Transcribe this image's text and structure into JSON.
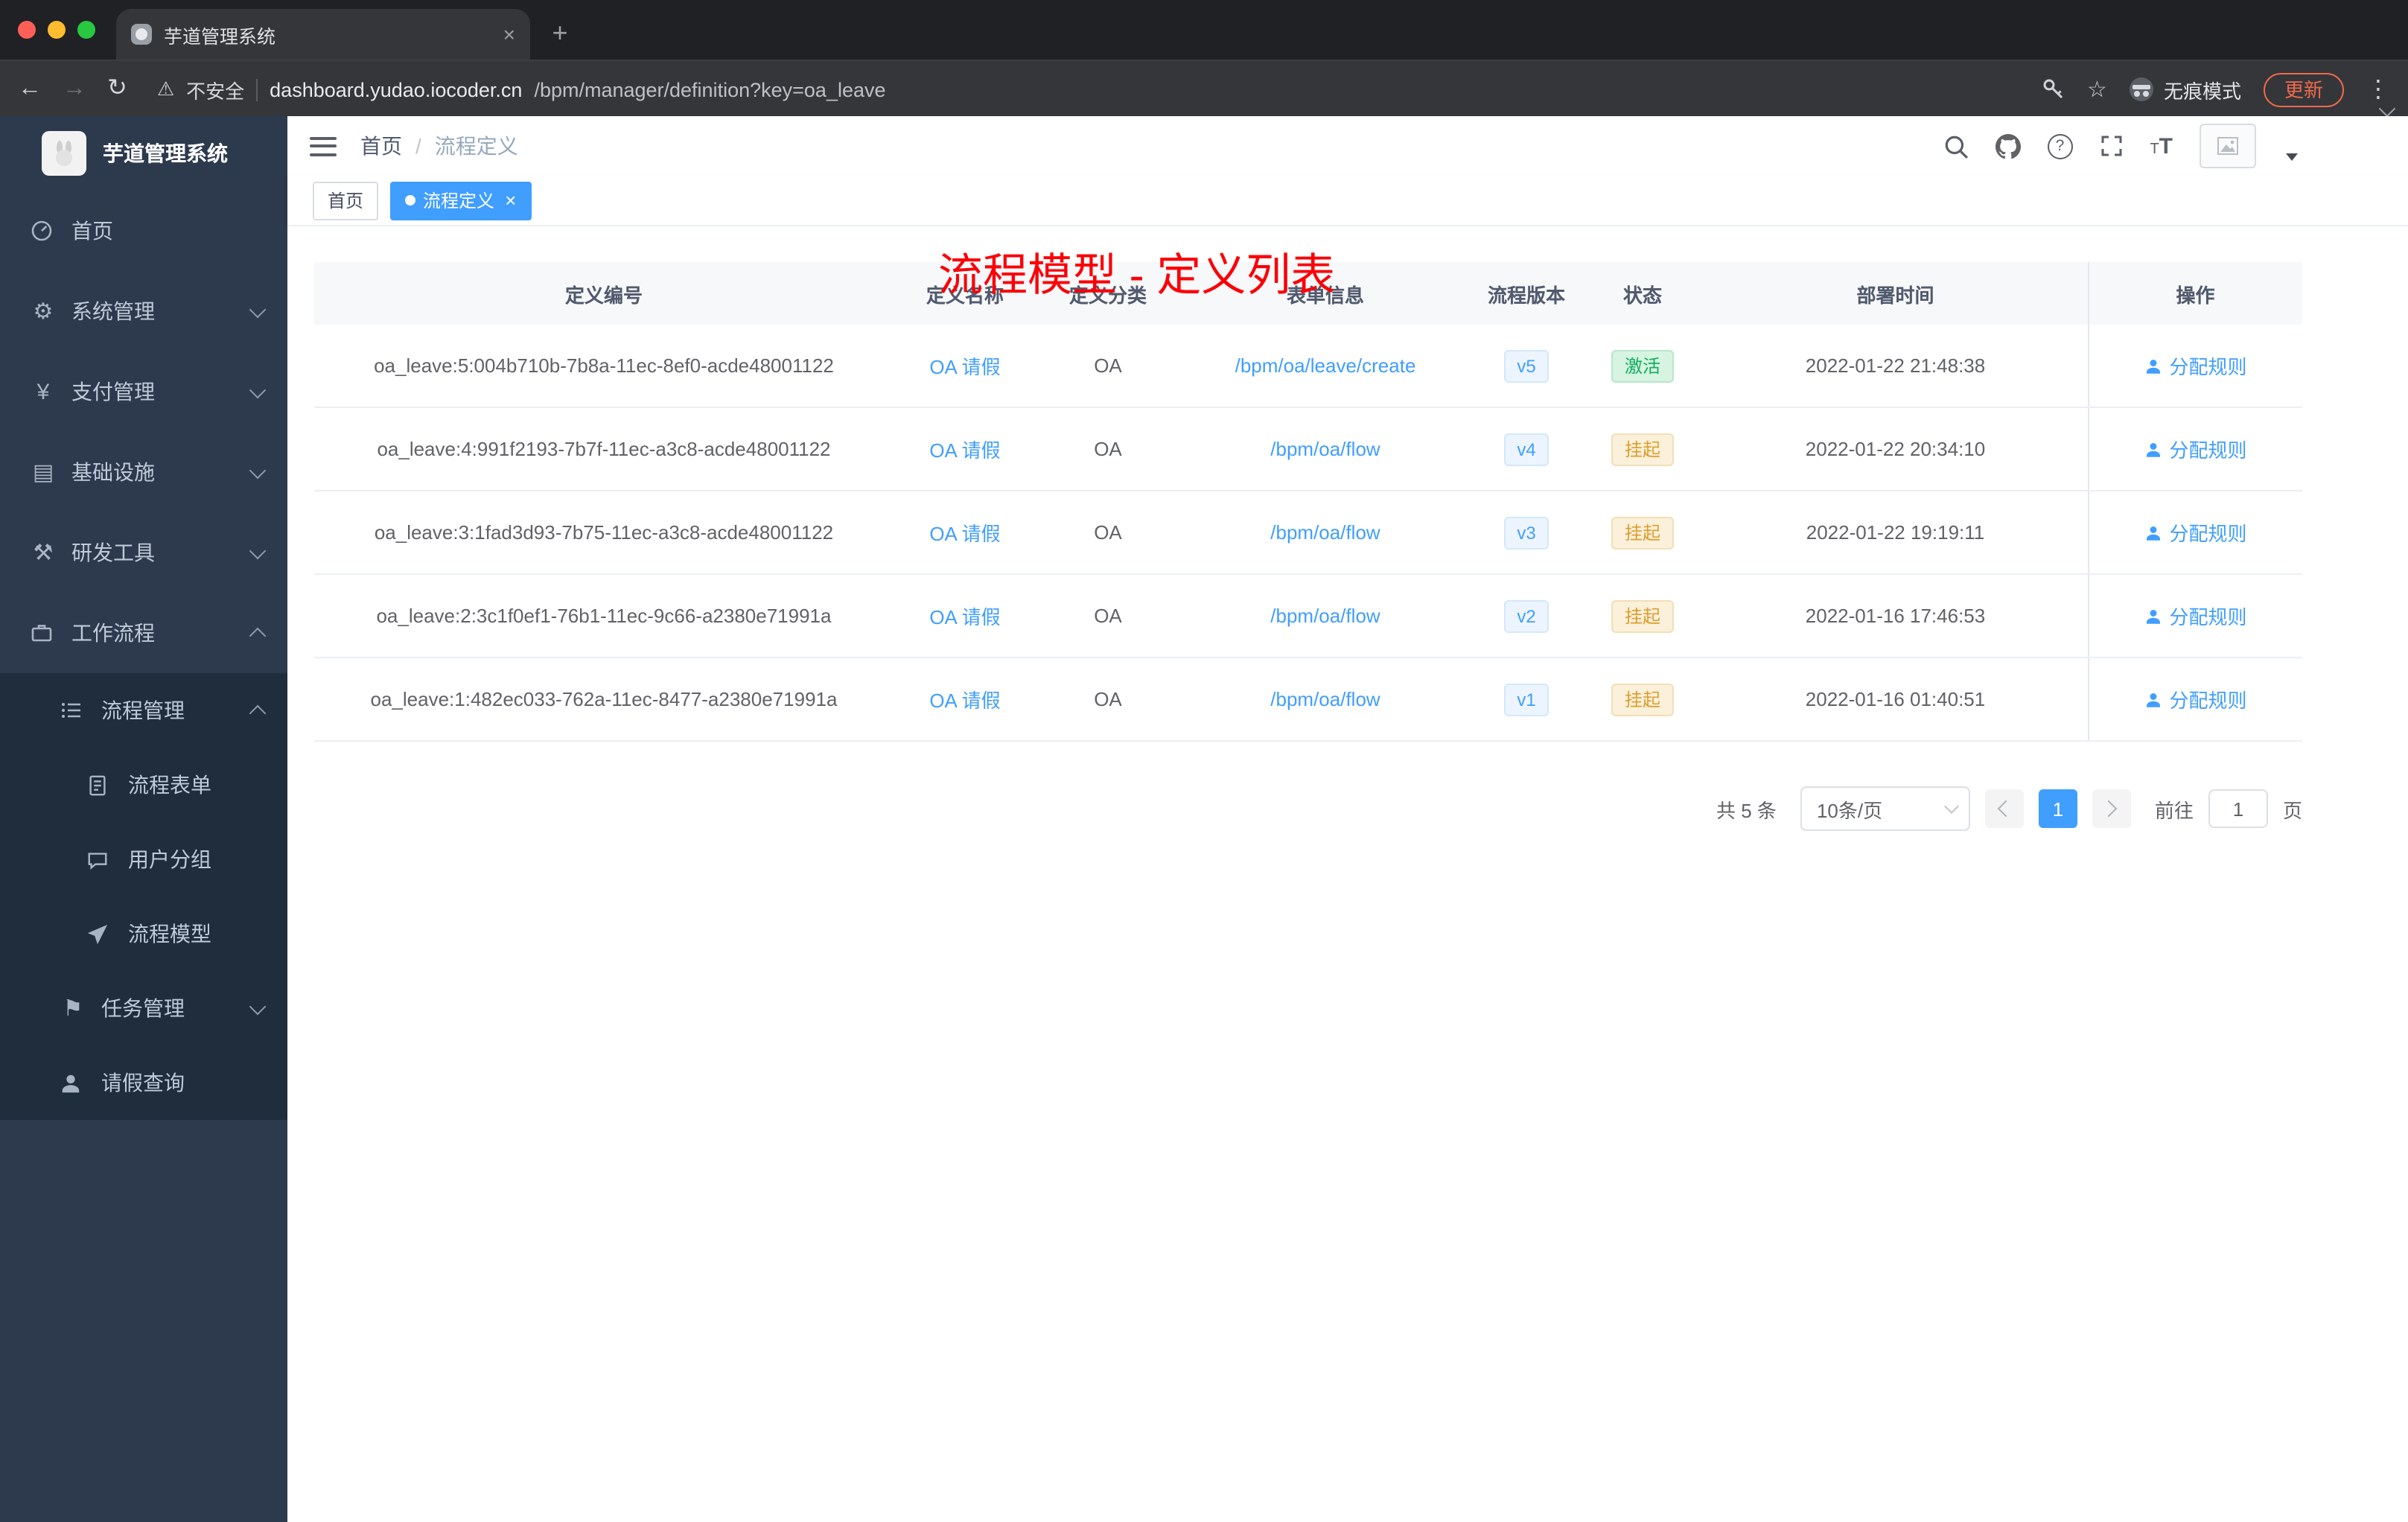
{
  "browser": {
    "tab_title": "芋道管理系统",
    "security_label": "不安全",
    "url_host": "dashboard.yudao.iocoder.cn",
    "url_path": "/bpm/manager/definition?key=oa_leave",
    "incognito_label": "无痕模式",
    "update_label": "更新"
  },
  "sidebar": {
    "logo_title": "芋道管理系统",
    "menu": [
      {
        "label": "首页"
      },
      {
        "label": "系统管理"
      },
      {
        "label": "支付管理"
      },
      {
        "label": "基础设施"
      },
      {
        "label": "研发工具"
      },
      {
        "label": "工作流程"
      }
    ],
    "submenu": {
      "group_label": "流程管理",
      "children": [
        {
          "label": "流程表单"
        },
        {
          "label": "用户分组"
        },
        {
          "label": "流程模型"
        }
      ],
      "task_label": "任务管理",
      "leave_label": "请假查询"
    }
  },
  "header": {
    "breadcrumb_home": "首页",
    "breadcrumb_sep": "/",
    "breadcrumb_current": "流程定义",
    "annotation": "流程模型 - 定义列表"
  },
  "tags": {
    "home": "首页",
    "active": "流程定义"
  },
  "table": {
    "columns": [
      "定义编号",
      "定义名称",
      "定义分类",
      "表单信息",
      "流程版本",
      "状态",
      "部署时间",
      "操作"
    ],
    "rows": [
      {
        "id": "oa_leave:5:004b710b-7b8a-11ec-8ef0-acde48001122",
        "name": "OA 请假",
        "category": "OA",
        "form": "/bpm/oa/leave/create",
        "version": "v5",
        "status": "激活",
        "status_type": "success",
        "time": "2022-01-22 21:48:38",
        "action": "分配规则"
      },
      {
        "id": "oa_leave:4:991f2193-7b7f-11ec-a3c8-acde48001122",
        "name": "OA 请假",
        "category": "OA",
        "form": "/bpm/oa/flow",
        "version": "v4",
        "status": "挂起",
        "status_type": "warning",
        "time": "2022-01-22 20:34:10",
        "action": "分配规则"
      },
      {
        "id": "oa_leave:3:1fad3d93-7b75-11ec-a3c8-acde48001122",
        "name": "OA 请假",
        "category": "OA",
        "form": "/bpm/oa/flow",
        "version": "v3",
        "status": "挂起",
        "status_type": "warning",
        "time": "2022-01-22 19:19:11",
        "action": "分配规则"
      },
      {
        "id": "oa_leave:2:3c1f0ef1-76b1-11ec-9c66-a2380e71991a",
        "name": "OA 请假",
        "category": "OA",
        "form": "/bpm/oa/flow",
        "version": "v2",
        "status": "挂起",
        "status_type": "warning",
        "time": "2022-01-16 17:46:53",
        "action": "分配规则"
      },
      {
        "id": "oa_leave:1:482ec033-762a-11ec-8477-a2380e71991a",
        "name": "OA 请假",
        "category": "OA",
        "form": "/bpm/oa/flow",
        "version": "v1",
        "status": "挂起",
        "status_type": "warning",
        "time": "2022-01-16 01:40:51",
        "action": "分配规则"
      }
    ]
  },
  "pagination": {
    "total": "共 5 条",
    "page_size": "10条/页",
    "page": "1",
    "goto": "前往",
    "unit": "页",
    "goto_value": "1"
  },
  "colors": {
    "accent": "#409eff",
    "success": "#0fae5d",
    "warning": "#dd9e2f",
    "annotation": "#fb0007"
  }
}
